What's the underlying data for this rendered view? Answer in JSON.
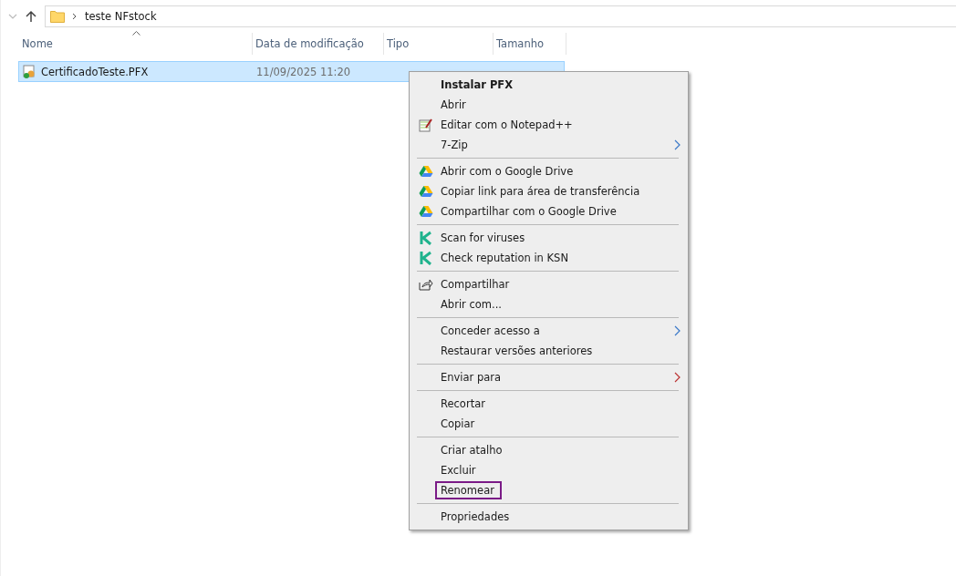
{
  "address_bar": {
    "path": [
      "teste NFstock"
    ]
  },
  "columns": [
    {
      "label": "Nome",
      "sorted": true
    },
    {
      "label": "Data de modificação",
      "sorted": false
    },
    {
      "label": "Tipo",
      "sorted": false
    },
    {
      "label": "Tamanho",
      "sorted": false
    }
  ],
  "files": [
    {
      "name": "CertificadoTeste.PFX",
      "modified": "11/09/2025 11:20",
      "selected": true
    }
  ],
  "context_menu": {
    "groups": [
      [
        {
          "label": "Instalar PFX",
          "default": true,
          "kind": "plain",
          "submenu": false,
          "outlined": false
        },
        {
          "label": "Abrir",
          "default": false,
          "kind": "plain",
          "submenu": false,
          "outlined": false
        },
        {
          "label": "Editar com o Notepad++",
          "default": false,
          "kind": "notepad",
          "submenu": false,
          "outlined": false
        },
        {
          "label": "7-Zip",
          "default": false,
          "kind": "plain",
          "submenu": true,
          "outlined": false
        }
      ],
      [
        {
          "label": "Abrir com o Google Drive",
          "default": false,
          "kind": "drive",
          "submenu": false,
          "outlined": false
        },
        {
          "label": "Copiar link para área de transferência",
          "default": false,
          "kind": "drive",
          "submenu": false,
          "outlined": false
        },
        {
          "label": "Compartilhar com o Google Drive",
          "default": false,
          "kind": "drive",
          "submenu": false,
          "outlined": false
        }
      ],
      [
        {
          "label": "Scan for viruses",
          "default": false,
          "kind": "kaspersky",
          "submenu": false,
          "outlined": false
        },
        {
          "label": "Check reputation in KSN",
          "default": false,
          "kind": "kaspersky",
          "submenu": false,
          "outlined": false
        }
      ],
      [
        {
          "label": "Compartilhar",
          "default": false,
          "kind": "share",
          "submenu": false,
          "outlined": false
        },
        {
          "label": "Abrir com...",
          "default": false,
          "kind": "plain",
          "submenu": false,
          "outlined": false
        }
      ],
      [
        {
          "label": "Conceder acesso a",
          "default": false,
          "kind": "plain",
          "submenu": true,
          "outlined": false
        },
        {
          "label": "Restaurar versões anteriores",
          "default": false,
          "kind": "plain",
          "submenu": false,
          "outlined": false
        }
      ],
      [
        {
          "label": "Enviar para",
          "default": false,
          "kind": "plain",
          "submenu": true,
          "outlined": false
        }
      ],
      [
        {
          "label": "Recortar",
          "default": false,
          "kind": "plain",
          "submenu": false,
          "outlined": false
        },
        {
          "label": "Copiar",
          "default": false,
          "kind": "plain",
          "submenu": false,
          "outlined": false
        }
      ],
      [
        {
          "label": "Criar atalho",
          "default": false,
          "kind": "plain",
          "submenu": false,
          "outlined": false
        },
        {
          "label": "Excluir",
          "default": false,
          "kind": "plain",
          "submenu": false,
          "outlined": false
        },
        {
          "label": "Renomear",
          "default": false,
          "kind": "plain",
          "submenu": false,
          "outlined": true
        }
      ],
      [
        {
          "label": "Propriedades",
          "default": false,
          "kind": "plain",
          "submenu": false,
          "outlined": false
        }
      ]
    ]
  }
}
